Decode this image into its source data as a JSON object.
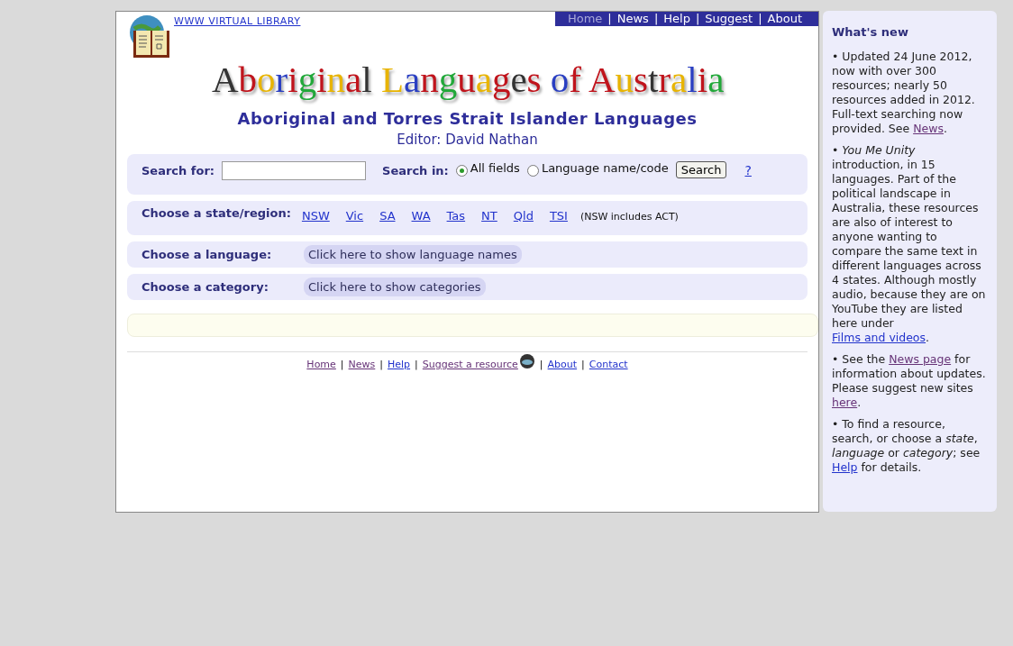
{
  "header": {
    "library_link": "WWW VIRTUAL LIBRARY",
    "title": "Aboriginal Languages of Australia",
    "subtitle": "Aboriginal and Torres Strait Islander Languages",
    "editor": "Editor: David Nathan"
  },
  "nav_separator": "|",
  "top_nav": [
    {
      "label": "Home",
      "selected": true
    },
    {
      "label": "News",
      "selected": false
    },
    {
      "label": "Help",
      "selected": false
    },
    {
      "label": "Suggest",
      "selected": false
    },
    {
      "label": "About",
      "selected": false
    }
  ],
  "search": {
    "label": "Search for:",
    "search_in_label": "Search in:",
    "options": [
      {
        "label": "All fields",
        "selected": true
      },
      {
        "label": "Language name/code",
        "selected": false
      }
    ],
    "button": "Search",
    "help_link": "?"
  },
  "region": {
    "label": "Choose a state/region:",
    "links": [
      "NSW",
      "Vic",
      "SA",
      "WA",
      "Tas",
      "NT",
      "Qld",
      "TSI"
    ],
    "note": "(NSW includes ACT)"
  },
  "language": {
    "label": "Choose a language:",
    "button": "Click here to show language names"
  },
  "category": {
    "label": "Choose a category:",
    "button": "Click here to show categories"
  },
  "footer_links": [
    {
      "label": "Home",
      "visited": true
    },
    {
      "label": "News",
      "visited": true
    },
    {
      "label": "Help",
      "visited": false
    },
    {
      "label": "Suggest a resource ",
      "visited": true,
      "icon": true
    },
    {
      "label": "About",
      "visited": false
    },
    {
      "label": "Contact",
      "visited": false
    }
  ],
  "sidebar": {
    "title": "What's new",
    "paragraphs": [
      [
        {
          "kind": "text",
          "text": "• Updated 24 June 2012, now with over 300 resources; nearly 50 resources added in 2012. Full-text searching now provided. See "
        },
        {
          "kind": "link",
          "text": "News",
          "visited": true
        },
        {
          "kind": "text",
          "text": "."
        }
      ],
      [
        {
          "kind": "text",
          "text": "• *You Me Unity* introduction, in 15 languages. Part of the political landscape in Australia, these resources are also of interest to anyone wanting to compare the same text in different languages across 4 states. Although mostly audio, because they are on YouTube they are listed here under "
        },
        {
          "kind": "link",
          "text": "Films and videos",
          "visited": false
        },
        {
          "kind": "text",
          "text": "."
        }
      ],
      [
        {
          "kind": "text",
          "text": "• See the "
        },
        {
          "kind": "link",
          "text": "News page",
          "visited": true
        },
        {
          "kind": "text",
          "text": " for information about updates. Please suggest new sites "
        },
        {
          "kind": "link",
          "text": "here",
          "visited": true
        },
        {
          "kind": "text",
          "text": "."
        }
      ],
      [
        {
          "kind": "text",
          "text": "• To find a resource, search, or choose a *state*, *language* or *category*; see "
        },
        {
          "kind": "link",
          "text": "Help",
          "visited": false
        },
        {
          "kind": "text",
          "text": " for details."
        }
      ]
    ]
  }
}
